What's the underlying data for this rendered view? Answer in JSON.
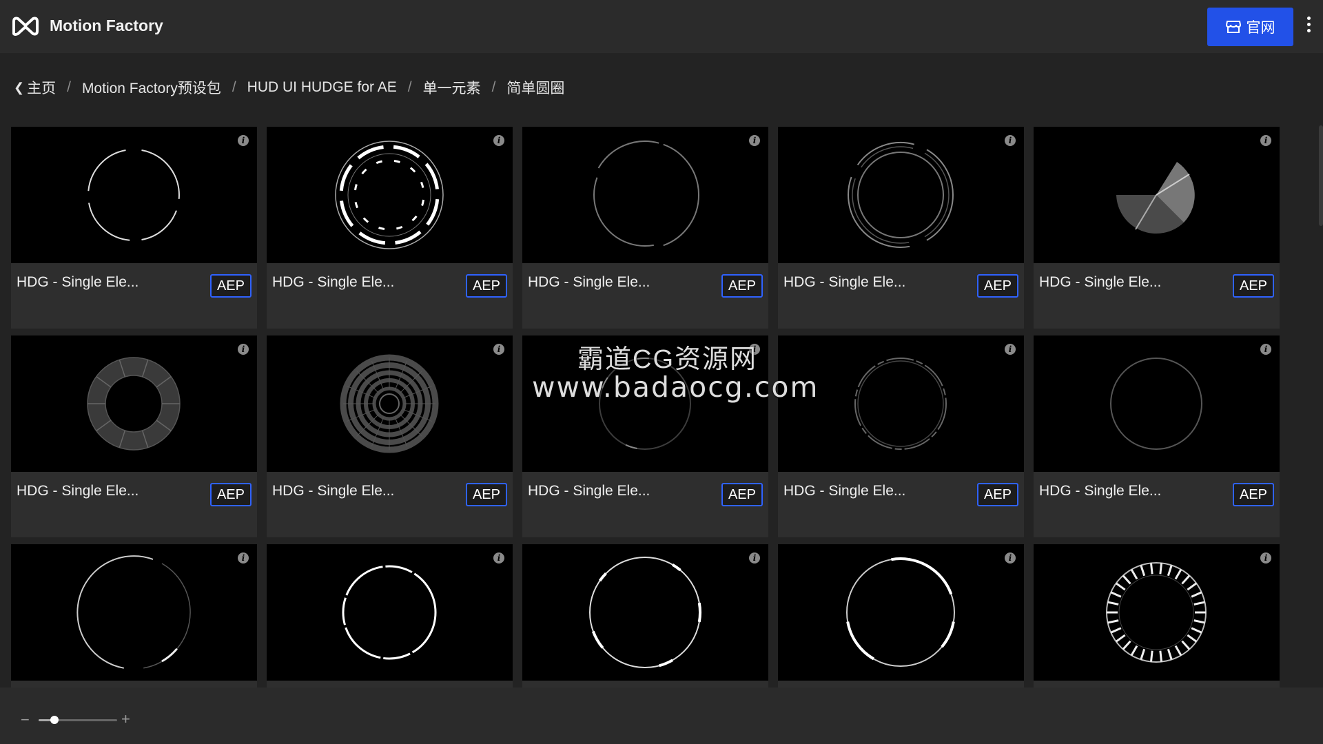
{
  "header": {
    "app_title": "Motion Factory",
    "site_button_label": "官网",
    "logo_icon": "motion-factory-logo",
    "more_icon": "more-vertical-icon",
    "accent_color": "#2251e8"
  },
  "breadcrumb": {
    "items": [
      "主页",
      "Motion Factory预设包",
      "HUD UI HUDGE for AE",
      "单一元素",
      "简单圆圈"
    ],
    "separator": "/"
  },
  "cards": [
    {
      "title": "HDG - Single Ele...",
      "badge": "AEP",
      "thumb": "open-ring-arcs"
    },
    {
      "title": "HDG - Single Ele...",
      "badge": "AEP",
      "thumb": "segmented-bold-rings"
    },
    {
      "title": "HDG - Single Ele...",
      "badge": "AEP",
      "thumb": "notched-thin-ring"
    },
    {
      "title": "HDG - Single Ele...",
      "badge": "AEP",
      "thumb": "double-notched-ring"
    },
    {
      "title": "HDG - Single Ele...",
      "badge": "AEP",
      "thumb": "pie-sector"
    },
    {
      "title": "HDG - Single Ele...",
      "badge": "AEP",
      "thumb": "segmented-donut"
    },
    {
      "title": "HDG - Single Ele...",
      "badge": "AEP",
      "thumb": "layered-gauge"
    },
    {
      "title": "HDG - Single Ele...",
      "badge": "AEP",
      "thumb": "thin-ring-dots"
    },
    {
      "title": "HDG - Single Ele...",
      "badge": "AEP",
      "thumb": "dashed-double-ring"
    },
    {
      "title": "HDG - Single Ele...",
      "badge": "AEP",
      "thumb": "plain-thin-ring"
    },
    {
      "title": "",
      "badge": "",
      "thumb": "partial-arc-ring"
    },
    {
      "title": "",
      "badge": "",
      "thumb": "bright-ring-notches"
    },
    {
      "title": "",
      "badge": "",
      "thumb": "ring-accent-ticks"
    },
    {
      "title": "",
      "badge": "",
      "thumb": "glow-ring-arcs"
    },
    {
      "title": "",
      "badge": "",
      "thumb": "radial-fins-ring"
    }
  ],
  "watermark": {
    "line1": "霸道CG资源网",
    "line2": "www.badaocg.com"
  },
  "zoom": {
    "minus_label": "−",
    "plus_label": "+",
    "level": 0.2
  }
}
